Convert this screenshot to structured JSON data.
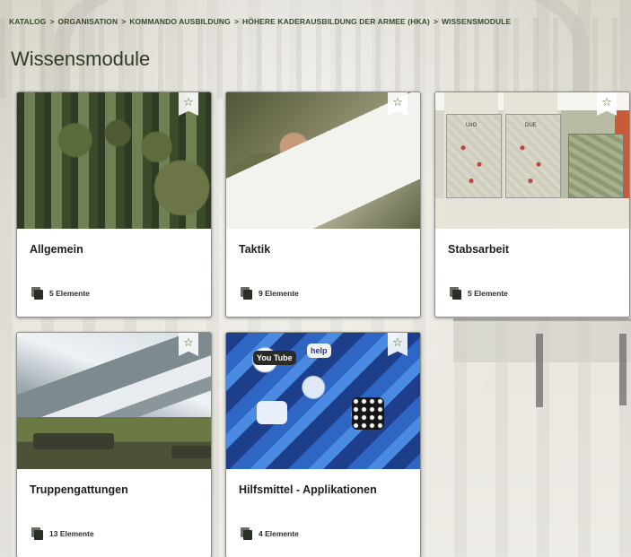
{
  "breadcrumb": [
    {
      "label": "KATALOG"
    },
    {
      "label": "ORGANISATION"
    },
    {
      "label": "KOMMANDO AUSBILDUNG"
    },
    {
      "label": "HÖHERE KADERAUSBILDUNG DER ARMEE (HKA)"
    },
    {
      "label": "WISSENSMODULE"
    }
  ],
  "breadcrumb_separator": ">",
  "page_title": "Wissensmodule",
  "favorite_icon": "☆",
  "cards": [
    {
      "title": "Allgemein",
      "count_label": "5 Elemente",
      "image": "soldiers-forest"
    },
    {
      "title": "Taktik",
      "count_label": "9 Elemente",
      "image": "map-writing"
    },
    {
      "title": "Stabsarbeit",
      "count_label": "5 Elemente",
      "image": "staff-maps"
    },
    {
      "title": "Truppengattungen",
      "count_label": "13 Elemente",
      "image": "mountains-tanks"
    },
    {
      "title": "Hilfsmittel - Applikationen",
      "count_label": "4 Elemente",
      "image": "app-icons"
    }
  ],
  "staff_map_labels": {
    "left": "UirO",
    "right": "DUE"
  },
  "app_labels": {
    "youtube": "You Tube",
    "help": "help"
  },
  "colors": {
    "accent": "#4a6a2c",
    "breadcrumb": "#3c4a2c",
    "title": "#2f3a26"
  }
}
